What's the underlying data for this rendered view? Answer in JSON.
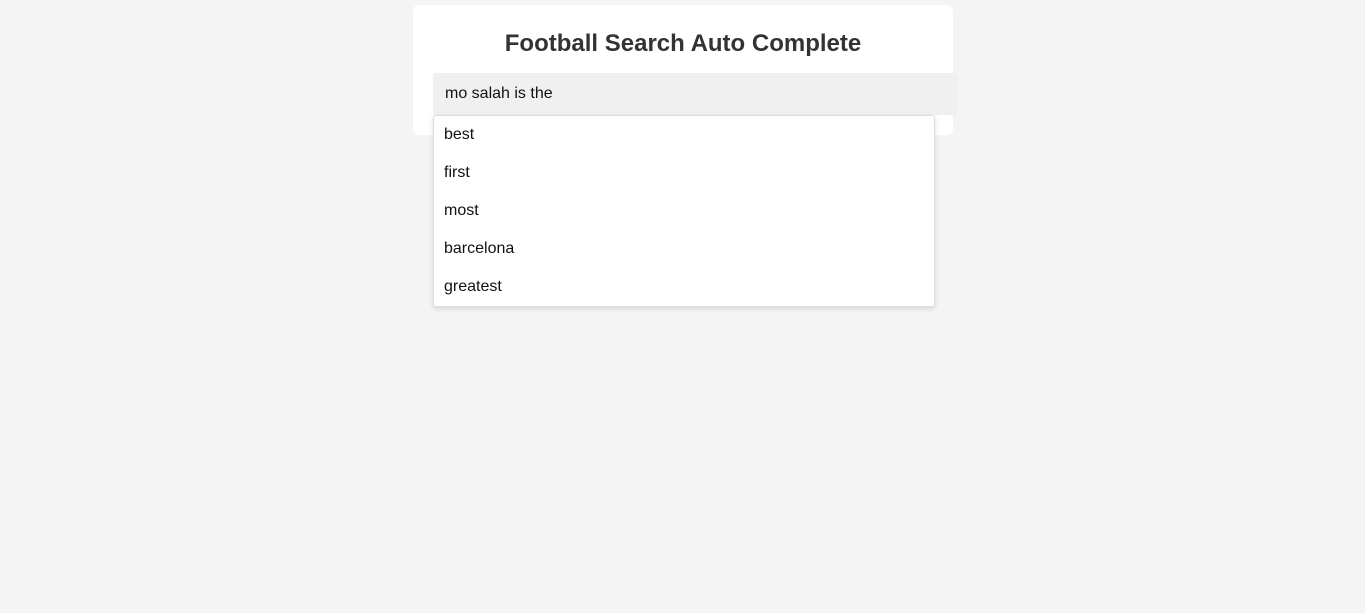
{
  "header": {
    "title": "Football Search Auto Complete"
  },
  "search": {
    "value": "mo salah is the",
    "placeholder": ""
  },
  "suggestions": [
    "best",
    "first",
    "most",
    "barcelona",
    "greatest"
  ]
}
